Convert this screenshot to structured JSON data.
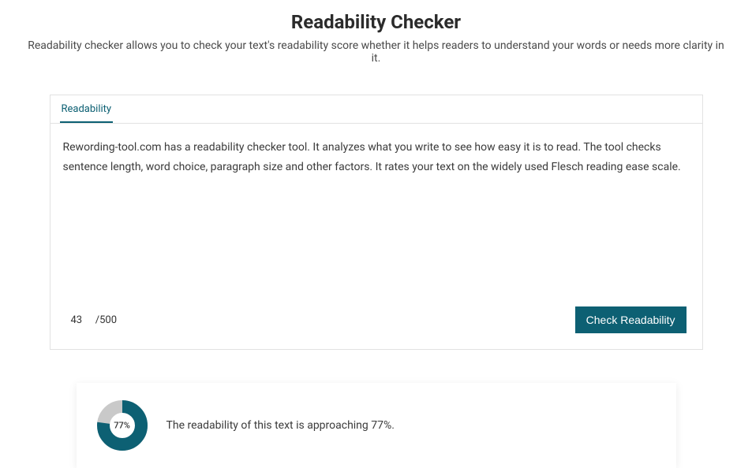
{
  "header": {
    "title": "Readability Checker",
    "subtitle": "Readability checker allows you to check your text's readability score whether it helps readers to understand your words or needs more clarity in it."
  },
  "editor": {
    "tab_label": "Readability",
    "content": "Rewording-tool.com has a readability checker tool. It analyzes what you write to see how easy it is to read. The tool checks sentence length, word choice, paragraph size and other factors. It rates your text on the widely used Flesch reading ease scale.",
    "word_count": "43",
    "word_limit": "/500",
    "button_label": "Check Readability"
  },
  "result": {
    "percent": 77,
    "percent_label": "77%",
    "description": "The readability of this text is approaching 77%."
  },
  "colors": {
    "accent": "#0d6073",
    "donut_bg": "#c9c9c9"
  }
}
